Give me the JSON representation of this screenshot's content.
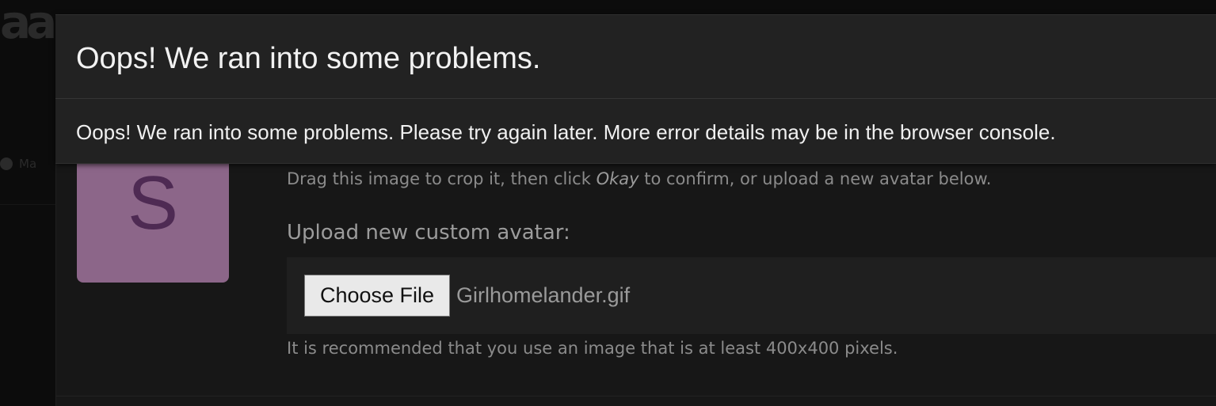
{
  "background": {
    "logo_text": "aa",
    "sidebar_item_label": "Ma"
  },
  "toast": {
    "title": "Oops! We ran into some problems.",
    "message": "Oops! We ran into some problems. Please try again later. More error details may be in the browser console."
  },
  "avatar": {
    "letter": "S",
    "color": "#8c6689",
    "letter_color": "#4e2a53"
  },
  "crop_hint": {
    "before": "Drag this image to crop it, then click ",
    "emphasis": "Okay",
    "after": " to confirm, or upload a new avatar below."
  },
  "upload": {
    "label": "Upload new custom avatar:",
    "button_label": "Choose File",
    "file_name": "Girlhomelander.gif",
    "recommendation": "It is recommended that you use an image that is at least 400x400 pixels."
  }
}
